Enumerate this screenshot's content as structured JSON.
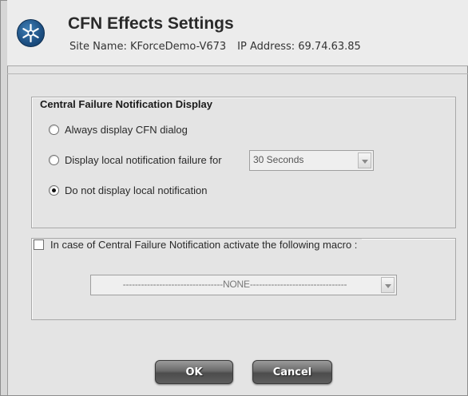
{
  "header": {
    "title": "CFN Effects Settings",
    "site_name_label": "Site Name: KForceDemo-V673",
    "ip_label": "IP Address: 69.74.63.85",
    "logo_icon": "snowflake-logo-icon"
  },
  "display_group": {
    "legend": "Central Failure Notification Display",
    "options": [
      {
        "label": "Always display CFN dialog",
        "selected": false
      },
      {
        "label": "Display local notification failure for",
        "selected": false
      },
      {
        "label": "Do not display local notification",
        "selected": true
      }
    ],
    "timeout_select": {
      "value": "30 Seconds",
      "enabled": false
    }
  },
  "macro_group": {
    "checkbox_label": "In case of Central Failure Notification activate the following macro :",
    "checked": false,
    "macro_select": {
      "value": "---------------------------------NONE--------------------------------",
      "enabled": false
    }
  },
  "buttons": {
    "ok": "OK",
    "cancel": "Cancel"
  }
}
